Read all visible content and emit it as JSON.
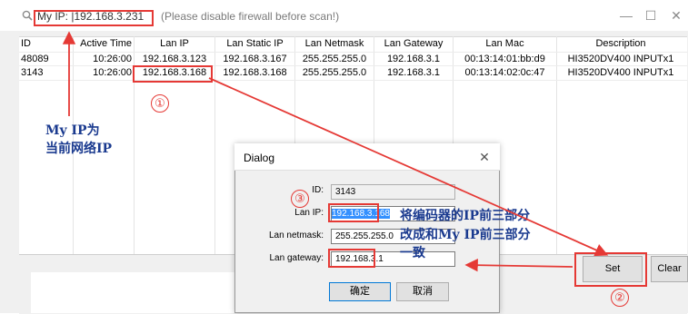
{
  "titlebar": {
    "title": "My IP: |192.168.3.231",
    "suffix": "(Please disable firewall before scan!)",
    "minimize": "—",
    "maximize": "☐",
    "close": "✕"
  },
  "table": {
    "columns": [
      "ID",
      "Active Time",
      "Lan IP",
      "Lan Static IP",
      "Lan Netmask",
      "Lan Gateway",
      "Lan Mac",
      "Description"
    ],
    "rows": [
      [
        "48089",
        "10:26:00",
        "192.168.3.123",
        "192.168.3.167",
        "255.255.255.0",
        "192.168.3.1",
        "00:13:14:01:bb:d9",
        "HI3520DV400 INPUTx1"
      ],
      [
        "3143",
        "10:26:00",
        "192.168.3.168",
        "192.168.3.168",
        "255.255.255.0",
        "192.168.3.1",
        "00:13:14:02:0c:47",
        "HI3520DV400 INPUTx1"
      ]
    ]
  },
  "buttons": {
    "set": "Set",
    "clear": "Clear"
  },
  "dialog": {
    "title": "Dialog",
    "close": "✕",
    "id_label": "ID:",
    "id_value": "3143",
    "ip_label": "Lan IP:",
    "ip_value": "192.168.3.168",
    "netmask_label": "Lan netmask:",
    "netmask_value": "255.255.255.0",
    "gateway_label": "Lan gateway:",
    "gateway_value": "192.168.3.1",
    "ok": "确定",
    "cancel": "取消"
  },
  "annotations": {
    "note_myip_line1": "My IP为",
    "note_myip_line2": "当前网络IP",
    "note_change_line1": "将编码器的IP前三部分",
    "note_change_line2": "改成和My IP前三部分",
    "note_change_line3": "一致",
    "num1": "①",
    "num2": "②",
    "num3": "③"
  },
  "colors": {
    "annotation_red": "#e53935",
    "annotation_blue": "#1a3a8f",
    "selection": "#3390ff"
  }
}
